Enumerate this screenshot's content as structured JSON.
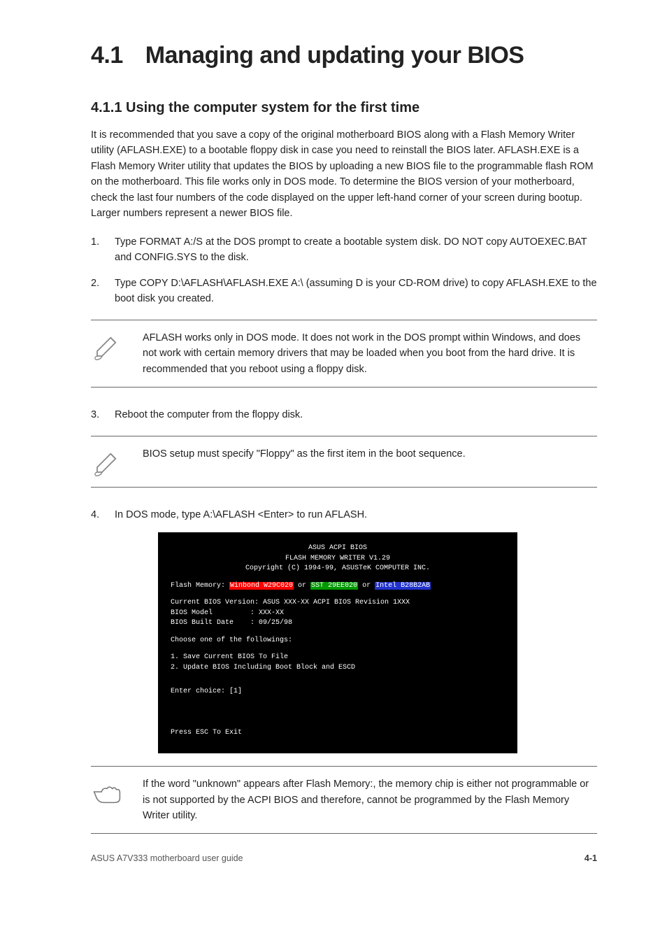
{
  "heading": {
    "number": "4.1",
    "title": "Managing and updating your BIOS"
  },
  "sub1": "4.1.1 Using the computer system for the first time",
  "para1": "It is recommended that you save a copy of the original motherboard BIOS along with a Flash Memory Writer utility (AFLASH.EXE) to a bootable floppy disk in case you need to reinstall the BIOS later. AFLASH.EXE is a Flash Memory Writer utility that updates the BIOS by uploading a new BIOS file to the programmable flash ROM on the motherboard. This file works only in DOS mode. To determine the BIOS version of your motherboard, check the last four numbers of the code displayed on the upper left-hand corner of your screen during bootup. Larger numbers represent a newer BIOS file.",
  "step1num": "1.",
  "step1": "Type FORMAT A:/S at the DOS prompt to create a bootable system disk. DO NOT copy AUTOEXEC.BAT and CONFIG.SYS to the disk.",
  "step2num": "2.",
  "step2": "Type COPY D:\\AFLASH\\AFLASH.EXE A:\\ (assuming D is your CD-ROM drive) to copy AFLASH.EXE to the boot disk you created.",
  "note1": "AFLASH works only in DOS mode. It does not work in the DOS prompt within Windows, and does not work with certain memory drivers that may be loaded when you boot from the hard drive. It is recommended that you reboot using a floppy disk.",
  "step3num": "3.",
  "step3": "Reboot the computer from the floppy disk.",
  "note2": "BIOS setup must specify \"Floppy\" as the first item in the boot sequence.",
  "step4num": "4.",
  "step4": "In DOS mode, type A:\\AFLASH <Enter> to run AFLASH.",
  "terminal": {
    "l1": "ASUS ACPI BIOS",
    "l2": "FLASH MEMORY WRITER V1.29",
    "l3": "Copyright (C) 1994-99, ASUSTeK COMPUTER INC.",
    "flash_label": "Flash Memory: ",
    "chip1": "Winbond W29C020",
    "or1": " or ",
    "chip2": "SST 29EE020",
    "or2": " or ",
    "chip3": "Intel B28B2AB",
    "cur_ver_label": "Current BIOS Version: ",
    "cur_ver": "ASUS XXX-XX ACPI BIOS Revision 1XXX",
    "model_label": "BIOS Model         : ",
    "model": "XXX-XX",
    "date_label": "BIOS Built Date    : ",
    "date": "09/25/98",
    "choose": "Choose one of the followings:",
    "opt1": "1. Save Current BIOS To File",
    "opt2": "2. Update BIOS Including Boot Block and ESCD",
    "enter": "Enter choice: [1]",
    "esc": "Press ESC To Exit"
  },
  "note3": "If the word \"unknown\" appears after Flash Memory:, the memory chip is either not programmable or is not supported by the ACPI BIOS and therefore, cannot be programmed by the Flash Memory Writer utility.",
  "footer": {
    "left": "ASUS A7V333 motherboard user guide",
    "right": "4-1"
  }
}
